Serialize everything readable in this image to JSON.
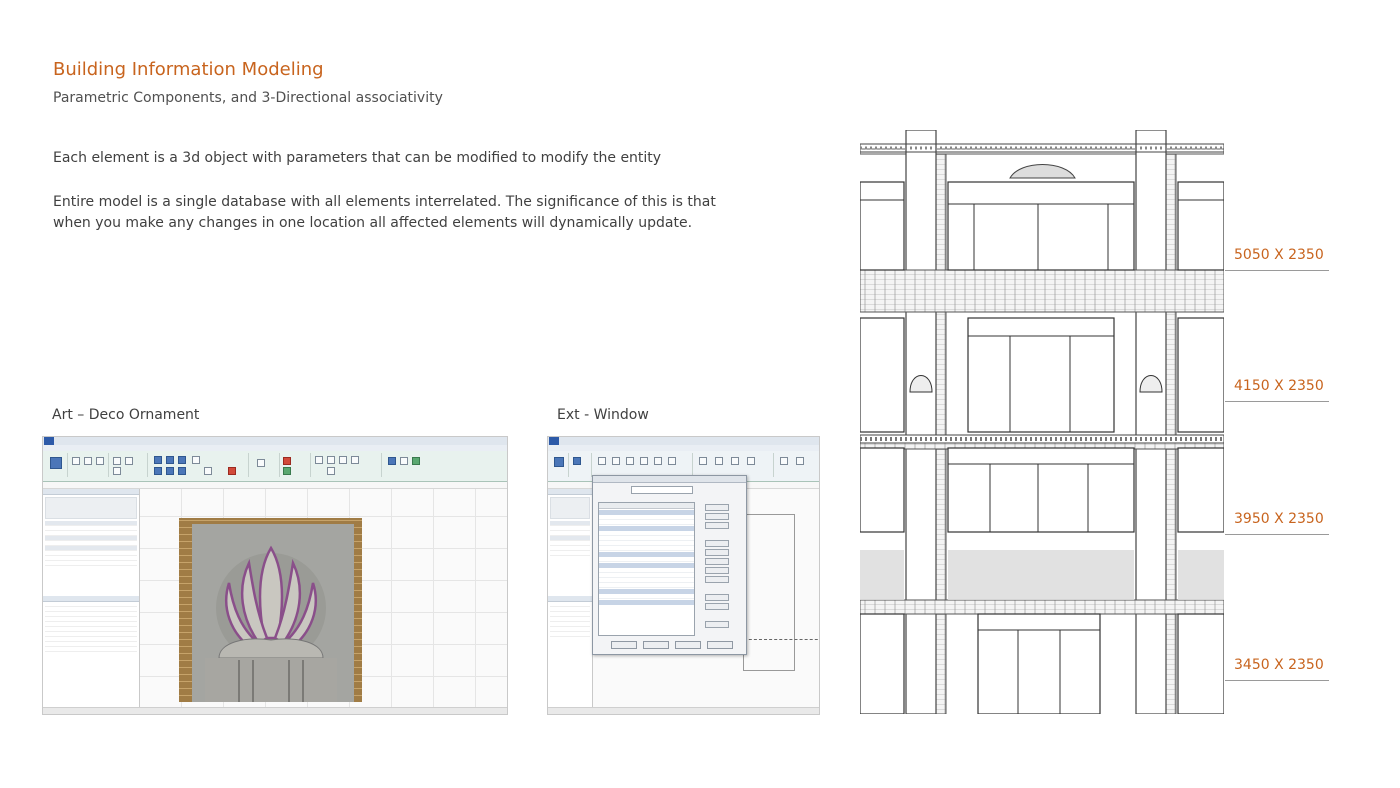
{
  "slide": {
    "title": "Building Information Modeling",
    "subtitle": "Parametric Components, and 3-Directional associativity",
    "paragraph1": "Each element is a 3d object with parameters that can be modified to modify the entity",
    "paragraph2": "Entire model is a single database with all elements interrelated. The significance of this is that when you make any changes in one location all affected elements will dynamically update."
  },
  "screenshots": {
    "art_deco_caption": "Art – Deco Ornament",
    "ext_window_caption": "Ext - Window"
  },
  "window_dimensions": [
    "5050 X 2350",
    "4150 X 2350",
    "3950 X 2350",
    "3450 X 2350"
  ],
  "colors": {
    "accent": "#c8641e",
    "body_text": "#404040",
    "revit_blue": "#2d5aa8"
  }
}
